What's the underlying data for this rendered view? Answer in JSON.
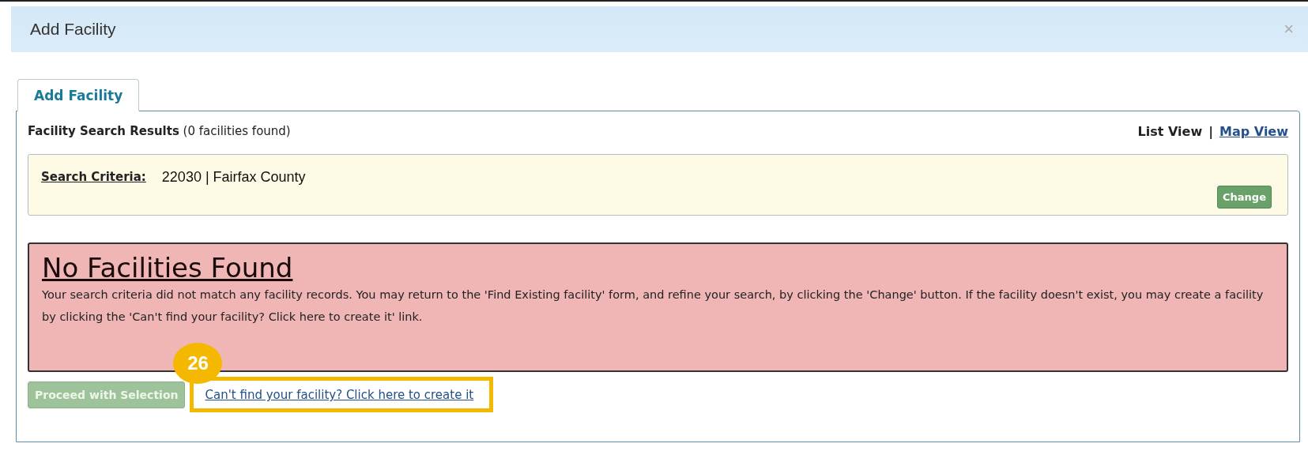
{
  "window": {
    "title": "Add Facility",
    "close": "×"
  },
  "tabs": [
    {
      "label": "Add Facility",
      "selected": true
    }
  ],
  "results": {
    "title": "Facility Search Results",
    "count": "(0 facilities found)"
  },
  "views": [
    {
      "label": "List View",
      "selected": true
    },
    {
      "label": "Map View",
      "selected": false
    }
  ],
  "view_separator": "|",
  "search_criteria": {
    "label": "Search Criteria:",
    "value": "22030 | Fairfax County",
    "button": "Change"
  },
  "alert": {
    "title": "No Facilities Found",
    "message": "Your search criteria did not match any facility records. You may return to the 'Find Existing facility' form, and refine your search, by clicking the 'Change' button. If the facility doesn't exist, you may create a facility by clicking the 'Can't find your facility? Click here to create it' link."
  },
  "proceed_button": {
    "label": "Proceed with Selection",
    "disabled": true
  },
  "create_link": "Can't find your facility? Click here to create it",
  "callout": {
    "number": "26"
  }
}
